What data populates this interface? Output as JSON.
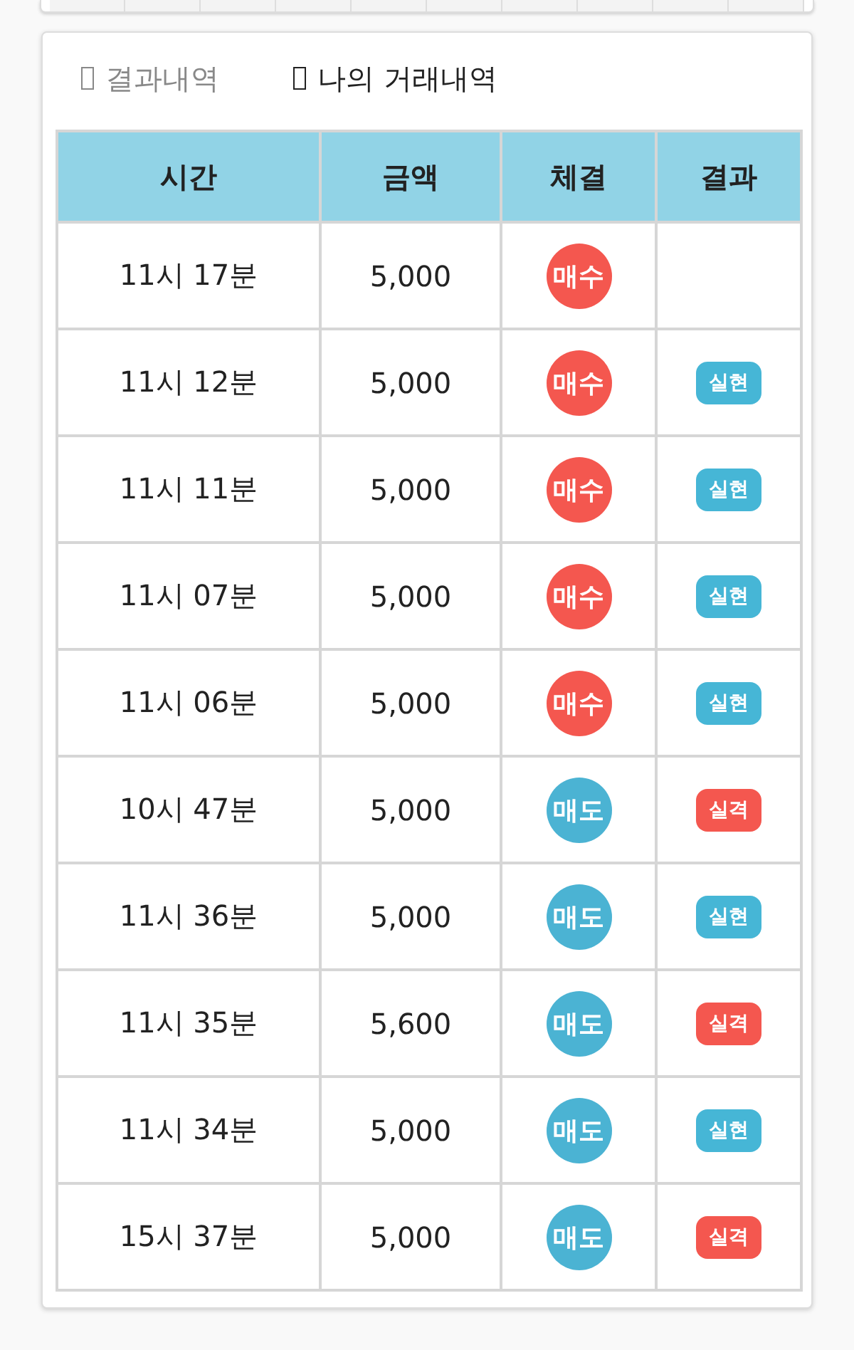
{
  "tabs": [
    {
      "label": "결과내역",
      "selected": false
    },
    {
      "label": "나의 거래내역",
      "selected": true
    }
  ],
  "table": {
    "columns": [
      "시간",
      "금액",
      "체결",
      "결과"
    ],
    "rows": [
      {
        "time": "11시 17분",
        "amount": "5,000",
        "trade": {
          "kind": "buy",
          "label": "매수"
        }
      },
      {
        "time": "11시 12분",
        "amount": "5,000",
        "trade": {
          "kind": "buy",
          "label": "매수"
        },
        "result": {
          "kind": "success",
          "label": "실현"
        }
      },
      {
        "time": "11시 11분",
        "amount": "5,000",
        "trade": {
          "kind": "buy",
          "label": "매수"
        },
        "result": {
          "kind": "success",
          "label": "실현"
        }
      },
      {
        "time": "11시 07분",
        "amount": "5,000",
        "trade": {
          "kind": "buy",
          "label": "매수"
        },
        "result": {
          "kind": "success",
          "label": "실현"
        }
      },
      {
        "time": "11시 06분",
        "amount": "5,000",
        "trade": {
          "kind": "buy",
          "label": "매수"
        },
        "result": {
          "kind": "success",
          "label": "실현"
        }
      },
      {
        "time": "10시 47분",
        "amount": "5,000",
        "trade": {
          "kind": "sell",
          "label": "매도"
        },
        "result": {
          "kind": "fail",
          "label": "실격"
        }
      },
      {
        "time": "11시 36분",
        "amount": "5,000",
        "trade": {
          "kind": "sell",
          "label": "매도"
        },
        "result": {
          "kind": "success",
          "label": "실현"
        }
      },
      {
        "time": "11시 35분",
        "amount": "5,600",
        "trade": {
          "kind": "sell",
          "label": "매도"
        },
        "result": {
          "kind": "fail",
          "label": "실격"
        }
      },
      {
        "time": "11시 34분",
        "amount": "5,000",
        "trade": {
          "kind": "sell",
          "label": "매도"
        },
        "result": {
          "kind": "success",
          "label": "실현"
        }
      },
      {
        "time": "15시 37분",
        "amount": "5,000",
        "trade": {
          "kind": "sell",
          "label": "매도"
        },
        "result": {
          "kind": "fail",
          "label": "실격"
        }
      }
    ]
  }
}
